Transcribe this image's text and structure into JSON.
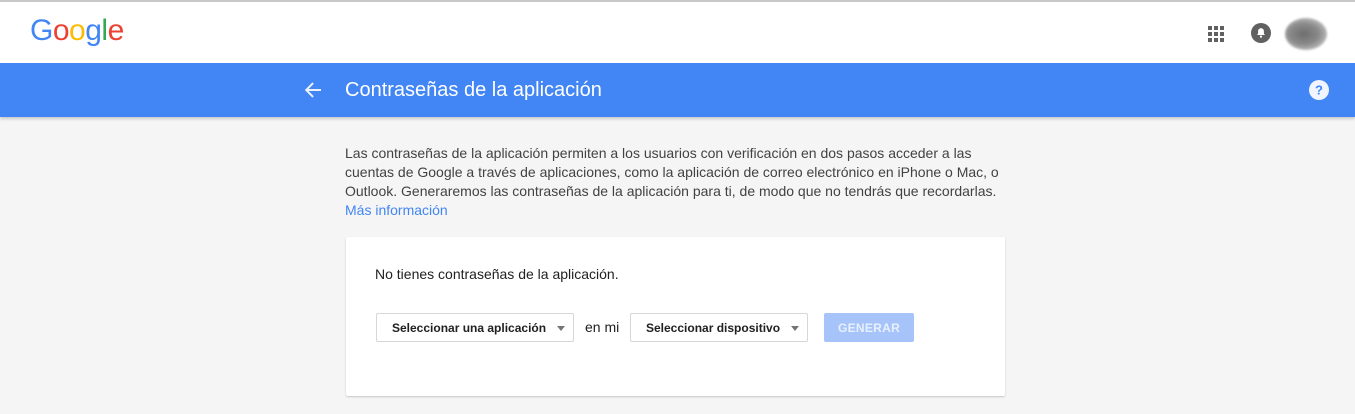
{
  "header": {
    "logo": {
      "letters": [
        {
          "char": "G",
          "color": "#4285f4"
        },
        {
          "char": "o",
          "color": "#ea4335"
        },
        {
          "char": "o",
          "color": "#fbbc05"
        },
        {
          "char": "g",
          "color": "#4285f4"
        },
        {
          "char": "l",
          "color": "#34a853"
        },
        {
          "char": "e",
          "color": "#ea4335"
        }
      ]
    },
    "icons": [
      "apps-grid-icon",
      "notifications-bell-icon",
      "account-avatar"
    ]
  },
  "titlebar": {
    "title": "Contraseñas de la aplicación",
    "background": "#4285f4",
    "back_icon": "arrow-left-icon",
    "help_icon": "help-circle-icon"
  },
  "description": {
    "text": "Las contraseñas de la aplicación permiten a los usuarios con verificación en dos pasos acceder a las cuentas de Google a través de aplicaciones, como la aplicación de correo electrónico en iPhone o Mac, o Outlook. Generaremos las contraseñas de la aplicación para ti, de modo que no tendrás que recordarlas.",
    "link": "Más información",
    "link_color": "#4285f4"
  },
  "card": {
    "empty_message": "No tienes contraseñas de la aplicación.",
    "select_app": "Seleccionar una aplicación",
    "connector": "en mi",
    "select_device": "Seleccionar dispositivo",
    "generate_button": "GENERAR",
    "generate_disabled": true
  }
}
